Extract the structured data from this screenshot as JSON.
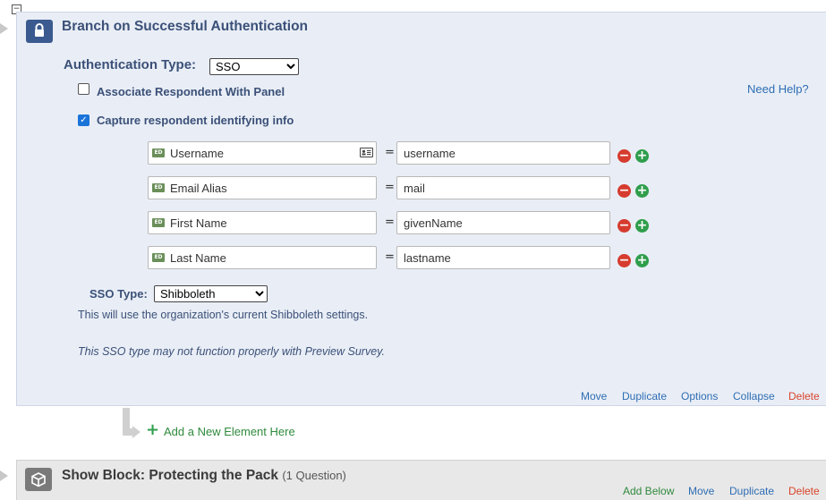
{
  "colors": {
    "panel_bg": "#e9eef6",
    "title": "#3b5078",
    "link": "#2f6db3",
    "delete": "#d9442b",
    "add_green": "#2f9e4c",
    "remove_red": "#d63b2f",
    "checkbox_blue": "#1a73d9"
  },
  "auth_element": {
    "collapse_toggle": "⊟",
    "title": "Branch on Successful Authentication",
    "icon": "lock-icon",
    "auth_type_label": "Authentication Type:",
    "auth_type_value": "SSO",
    "associate_label": "Associate Respondent With Panel",
    "associate_checked": false,
    "capture_label": "Capture respondent identifying info",
    "capture_checked": true,
    "need_help": "Need Help?",
    "field_tag": "ED",
    "fields": [
      {
        "label": "Username",
        "equals": "=",
        "value": "username"
      },
      {
        "label": "Email Alias",
        "equals": "=",
        "value": "mail"
      },
      {
        "label": "First Name",
        "equals": "=",
        "value": "givenName"
      },
      {
        "label": "Last Name",
        "equals": "=",
        "value": "lastname"
      }
    ],
    "sso_type_label": "SSO Type:",
    "sso_type_value": "Shibboleth",
    "sso_desc": "This will use the organization's current Shibboleth settings.",
    "sso_warning": "This SSO type may not function properly with Preview Survey.",
    "actions": {
      "move": "Move",
      "duplicate": "Duplicate",
      "options": "Options",
      "collapse": "Collapse",
      "delete": "Delete"
    }
  },
  "add_element": {
    "plus": "+",
    "label": "Add a New Element Here"
  },
  "block": {
    "icon": "cube-icon",
    "title": "Show Block: Protecting the Pack",
    "count": "(1 Question)",
    "actions": {
      "add_below": "Add Below",
      "move": "Move",
      "duplicate": "Duplicate",
      "delete": "Delete"
    }
  }
}
